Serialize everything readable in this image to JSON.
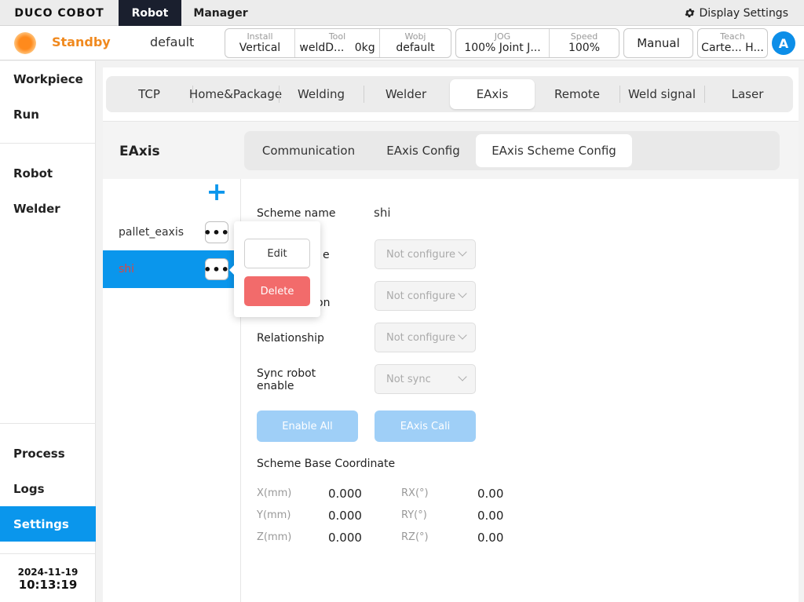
{
  "topbar": {
    "logo": "DUCO COBOT",
    "tabs": [
      {
        "label": "Robot",
        "active": true
      },
      {
        "label": "Manager",
        "active": false
      }
    ],
    "display_settings": "Display Settings"
  },
  "status": {
    "state": "Standby",
    "state_color": "#f0891e",
    "project": "default",
    "install": {
      "caption": "Install",
      "value": "Vertical"
    },
    "tool": {
      "caption": "Tool",
      "value": "weldD...",
      "extra": "0kg"
    },
    "wobj": {
      "caption": "Wobj",
      "value": "default"
    },
    "jog": {
      "caption": "JOG",
      "value": "100% Joint J..."
    },
    "speed": {
      "caption": "Speed",
      "value": "100%"
    },
    "mode": "Manual",
    "teach": {
      "caption": "Teach",
      "value": "Carte... H..."
    },
    "avatar": "A"
  },
  "sidebar": {
    "top_items": [
      "Workpiece",
      "Run"
    ],
    "mid_items": [
      "Robot",
      "Welder"
    ],
    "bottom_items": [
      "Process",
      "Logs",
      "Settings"
    ],
    "active": "Settings",
    "date": "2024-11-19",
    "time": "10:13:19"
  },
  "main_tabs": [
    "TCP",
    "Home&Package",
    "Welding",
    "Welder",
    "EAxis",
    "Remote",
    "Weld signal",
    "Laser"
  ],
  "main_tab_active": "EAxis",
  "section_title": "EAxis",
  "sub_tabs": [
    "Communication",
    "EAxis Config",
    "EAxis Scheme Config"
  ],
  "sub_tab_active": "EAxis Scheme Config",
  "schemes": [
    {
      "name": "pallet_eaxis",
      "active": false
    },
    {
      "name": "shi",
      "active": true
    }
  ],
  "popup": {
    "edit": "Edit",
    "delete": "Delete"
  },
  "form": {
    "scheme_name_label": "Scheme name",
    "scheme_name_value": "shi",
    "row2_label_visible": "e",
    "row3_label_visible": "on",
    "relationship_label": "Relationship",
    "sync_label_line1": "Sync robot",
    "sync_label_line2": "enable",
    "select_not_configured": "Not configure",
    "select_not_sync": "Not sync",
    "enable_all": "Enable All",
    "eaxis_cali": "EAxis Cali",
    "base_coord_title": "Scheme Base Coordinate",
    "coords": [
      {
        "label": "X(mm)",
        "value": "0.000",
        "rlabel": "RX(°)",
        "rvalue": "0.00"
      },
      {
        "label": "Y(mm)",
        "value": "0.000",
        "rlabel": "RY(°)",
        "rvalue": "0.00"
      },
      {
        "label": "Z(mm)",
        "value": "0.000",
        "rlabel": "RZ(°)",
        "rvalue": "0.00"
      }
    ]
  }
}
